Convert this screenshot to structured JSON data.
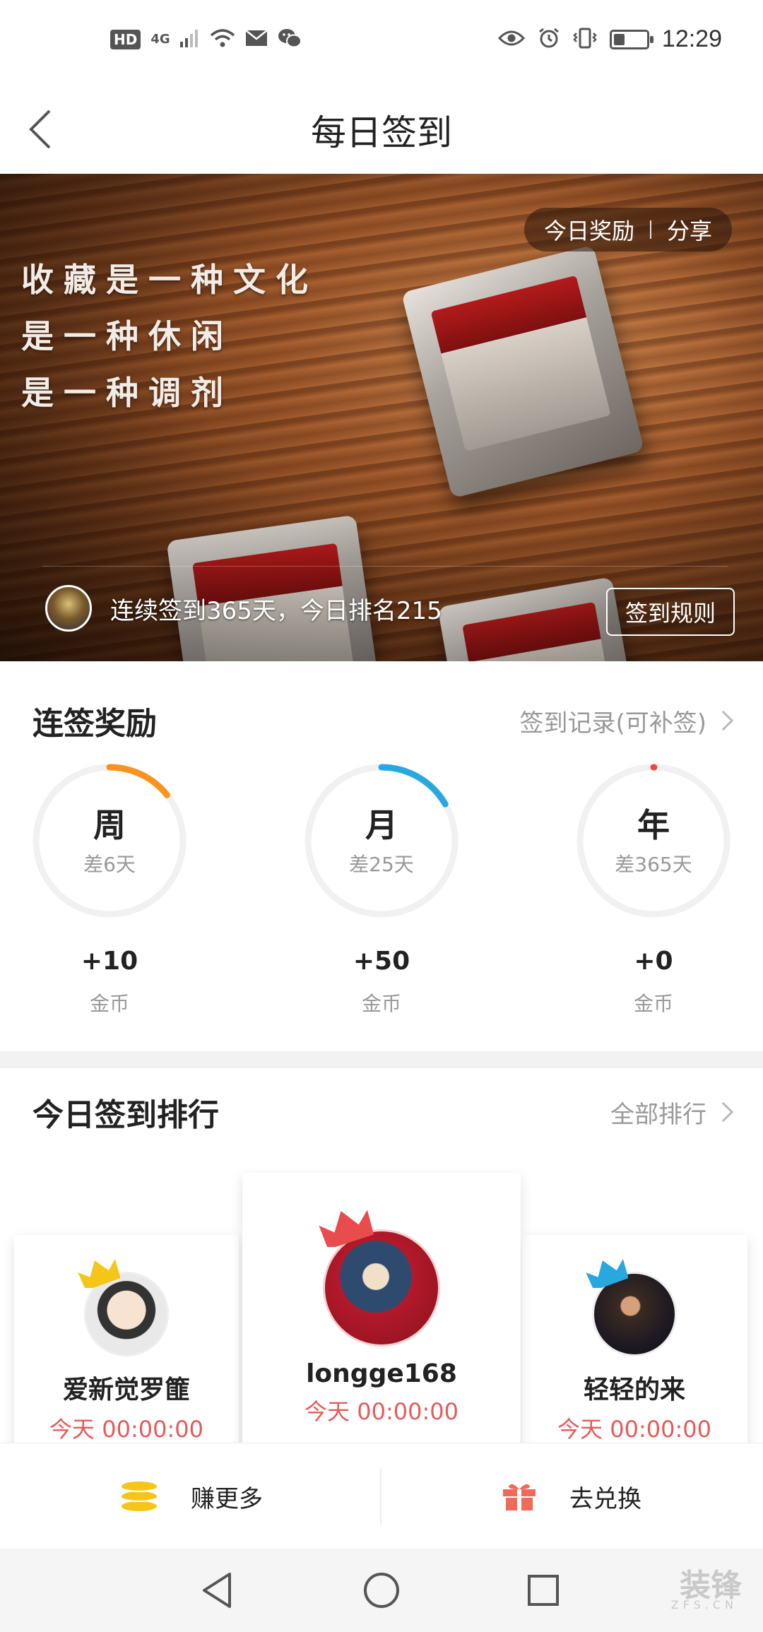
{
  "status_bar": {
    "hd": "HD",
    "network": "4G",
    "time": "12:29",
    "battery_level": 0.35
  },
  "header": {
    "title": "每日签到",
    "back_icon": "chevron-left-icon"
  },
  "banner": {
    "poem": [
      "收藏是一种文化",
      "是一种休闲",
      "是一种调剂"
    ],
    "today_reward": "今日奖励",
    "share": "分享",
    "streak_text": "连续签到365天，今日排名215",
    "rules_button": "签到规则"
  },
  "rewards": {
    "title": "连签奖励",
    "record_link": "签到记录(可补签)",
    "items": [
      {
        "period": "周",
        "remaining": "差6天",
        "amount": "+10",
        "unit": "金币",
        "progress": 0.143,
        "color": "#F7931E"
      },
      {
        "period": "月",
        "remaining": "差25天",
        "amount": "+50",
        "unit": "金币",
        "progress": 0.167,
        "color": "#29A8E0"
      },
      {
        "period": "年",
        "remaining": "差365天",
        "amount": "+0",
        "unit": "金币",
        "progress": 0.0,
        "color": "#E94B3C"
      }
    ]
  },
  "ranking": {
    "title": "今日签到排行",
    "all_link": "全部排行",
    "podium": [
      {
        "place": 2,
        "name": "爱新觉罗篚",
        "time": "今天 00:00:00",
        "crown_color": "#F5C518"
      },
      {
        "place": 1,
        "name": "longge168",
        "time": "今天 00:00:00",
        "crown_color": "#E84C4C"
      },
      {
        "place": 3,
        "name": "轻轻的来",
        "time": "今天 00:00:00",
        "crown_color": "#29A8E0"
      }
    ]
  },
  "action_bar": {
    "earn_more": "赚更多",
    "redeem": "去兑换"
  },
  "nav_bar": {
    "watermark": "装锋",
    "watermark_sub": "ZFS.CN"
  },
  "colors": {
    "accent_red": "#E55A5A",
    "muted_text": "#999999",
    "coin_yellow": "#F5C518",
    "gift_red": "#F06A5A"
  }
}
